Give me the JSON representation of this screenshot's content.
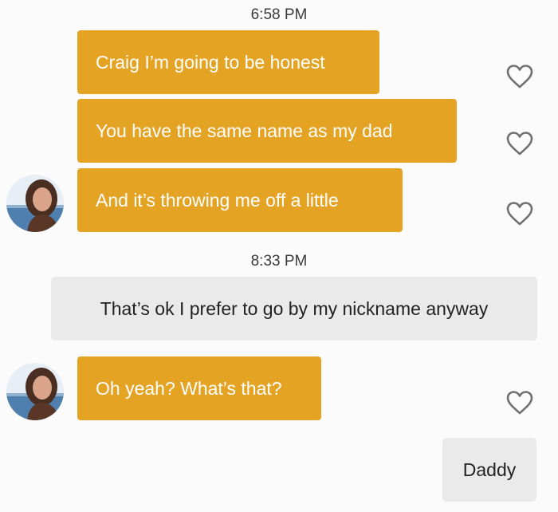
{
  "conversation": {
    "groups": [
      {
        "timestamp": "6:58 PM",
        "messages": [
          {
            "sender": "them",
            "text": "Craig I’m going to be honest"
          },
          {
            "sender": "them",
            "text": "You have the same name as my dad"
          },
          {
            "sender": "them",
            "text": "And it’s throwing me off a little"
          }
        ]
      },
      {
        "timestamp": "8:33 PM",
        "messages": [
          {
            "sender": "me",
            "text": "That’s ok I prefer to go by my nickname anyway"
          },
          {
            "sender": "them",
            "text": "Oh yeah? What’s that?"
          },
          {
            "sender": "me",
            "text": "Daddy"
          }
        ]
      }
    ]
  },
  "colors": {
    "incoming_bubble": "#e5a323",
    "outgoing_bubble": "#eaeaea",
    "background": "#fbfbfb"
  },
  "icons": {
    "like": "heart-outline-icon",
    "avatar": "profile-photo"
  }
}
